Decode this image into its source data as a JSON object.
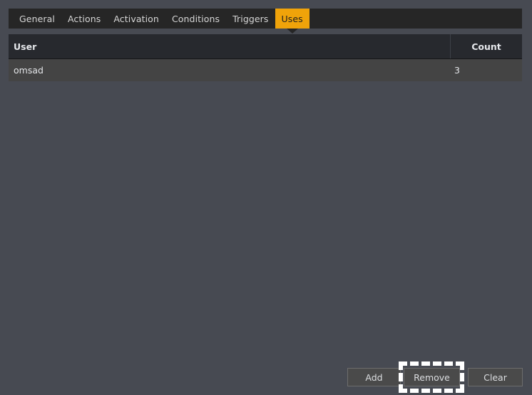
{
  "window": {
    "background_color": "#474a52"
  },
  "tabbar": {
    "background_color": "#262626",
    "active_color": "#f0a30a",
    "tabs": [
      {
        "label": "General",
        "active": false
      },
      {
        "label": "Actions",
        "active": false
      },
      {
        "label": "Activation",
        "active": false
      },
      {
        "label": "Conditions",
        "active": false
      },
      {
        "label": "Triggers",
        "active": false
      },
      {
        "label": "Uses",
        "active": true
      }
    ]
  },
  "table": {
    "header_background": "#27292e",
    "row_background": "#444444",
    "columns": [
      {
        "key": "user",
        "label": "User",
        "align": "left"
      },
      {
        "key": "count",
        "label": "Count",
        "align": "center"
      }
    ],
    "rows": [
      {
        "user": "omsad",
        "count": "3"
      }
    ]
  },
  "buttons": {
    "add": "Add",
    "remove": "Remove",
    "clear": "Clear"
  },
  "focus": {
    "target": "Remove",
    "style": "dashed-white-rectangle"
  }
}
